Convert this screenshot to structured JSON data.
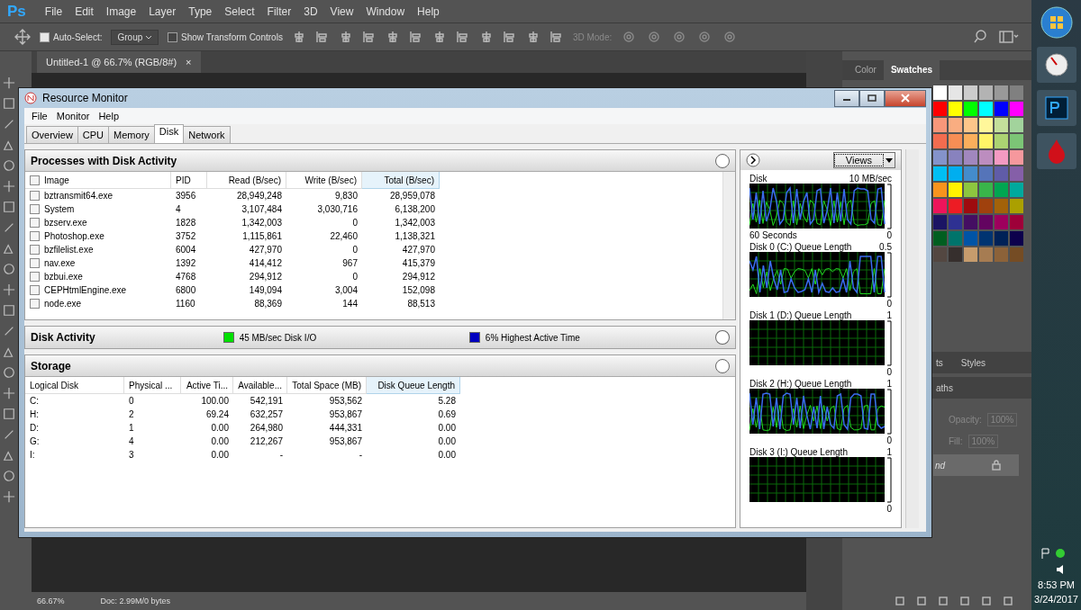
{
  "photoshop": {
    "logo": "Ps",
    "menu": [
      "File",
      "Edit",
      "Image",
      "Layer",
      "Type",
      "Select",
      "Filter",
      "3D",
      "View",
      "Window",
      "Help"
    ],
    "options": {
      "auto_select": {
        "label": "Auto-Select:",
        "checked": true
      },
      "group": "Group",
      "transform": {
        "label": "Show Transform Controls",
        "checked": false
      },
      "mode_3d": "3D Mode:"
    },
    "document_tab": {
      "title": "Untitled-1 @ 66.7% (RGB/8#)",
      "close": "×"
    },
    "panel_tabs": [
      {
        "label": "Color",
        "selected": false
      },
      {
        "label": "Swatches",
        "selected": true
      }
    ],
    "styles_tabs": [
      "ts",
      "Styles"
    ],
    "paths_tab": "aths",
    "opacity": {
      "label": "Opacity:",
      "value": "100%"
    },
    "fill": {
      "label": "Fill:",
      "value": "100%"
    },
    "layer": "nd",
    "status": {
      "zoom": "66.67%",
      "doc": "Doc: 2.99M/0 bytes"
    }
  },
  "resource_monitor": {
    "title": "Resource Monitor",
    "menu": [
      "File",
      "Monitor",
      "Help"
    ],
    "tabs": [
      {
        "label": "Overview",
        "selected": false
      },
      {
        "label": "CPU",
        "selected": false
      },
      {
        "label": "Memory",
        "selected": false
      },
      {
        "label": "Disk",
        "selected": true
      },
      {
        "label": "Network",
        "selected": false
      }
    ],
    "processes": {
      "title": "Processes with Disk Activity",
      "columns": [
        {
          "label": "Image",
          "sorted": false
        },
        {
          "label": "PID",
          "sorted": false
        },
        {
          "label": "Read (B/sec)",
          "sorted": false
        },
        {
          "label": "Write (B/sec)",
          "sorted": false
        },
        {
          "label": "Total (B/sec)",
          "sorted": true
        }
      ],
      "rows": [
        {
          "checked": false,
          "cells": [
            "bztransmit64.exe",
            "3956",
            "28,949,248",
            "9,830",
            "28,959,078"
          ]
        },
        {
          "checked": false,
          "cells": [
            "System",
            "4",
            "3,107,484",
            "3,030,716",
            "6,138,200"
          ]
        },
        {
          "checked": false,
          "cells": [
            "bzserv.exe",
            "1828",
            "1,342,003",
            "0",
            "1,342,003"
          ]
        },
        {
          "checked": false,
          "cells": [
            "Photoshop.exe",
            "3752",
            "1,115,861",
            "22,460",
            "1,138,321"
          ]
        },
        {
          "checked": false,
          "cells": [
            "bzfilelist.exe",
            "6004",
            "427,970",
            "0",
            "427,970"
          ]
        },
        {
          "checked": false,
          "cells": [
            "nav.exe",
            "1392",
            "414,412",
            "967",
            "415,379"
          ]
        },
        {
          "checked": false,
          "cells": [
            "bzbui.exe",
            "4768",
            "294,912",
            "0",
            "294,912"
          ]
        },
        {
          "checked": false,
          "cells": [
            "CEPHtmlEngine.exe",
            "6800",
            "149,094",
            "3,004",
            "152,098"
          ]
        },
        {
          "checked": false,
          "cells": [
            "node.exe",
            "1160",
            "88,369",
            "144",
            "88,513"
          ]
        }
      ]
    },
    "disk_activity": {
      "title": "Disk Activity",
      "legend": [
        {
          "label": "45 MB/sec Disk I/O",
          "color": "#00e000"
        },
        {
          "label": "6% Highest Active Time",
          "color": "#0000c0"
        }
      ]
    },
    "storage": {
      "title": "Storage",
      "columns": [
        {
          "label": "Logical Disk",
          "sorted": false
        },
        {
          "label": "Physical ...",
          "sorted": false
        },
        {
          "label": "Active Ti...",
          "sorted": false
        },
        {
          "label": "Available...",
          "sorted": false
        },
        {
          "label": "Total Space (MB)",
          "sorted": false
        },
        {
          "label": "Disk Queue Length",
          "sorted": true
        }
      ],
      "rows": [
        [
          "C:",
          "0",
          "100.00",
          "542,191",
          "953,562",
          "5.28"
        ],
        [
          "H:",
          "2",
          "69.24",
          "632,257",
          "953,867",
          "0.69"
        ],
        [
          "D:",
          "1",
          "0.00",
          "264,980",
          "444,331",
          "0.00"
        ],
        [
          "G:",
          "4",
          "0.00",
          "212,267",
          "953,867",
          "0.00"
        ],
        [
          "I:",
          "3",
          "0.00",
          "-",
          "-",
          "0.00"
        ]
      ]
    },
    "views_button": "Views",
    "graphs": [
      {
        "title": "Disk",
        "max": "10 MB/sec",
        "footer": "60 Seconds",
        "min": "0"
      },
      {
        "title": "Disk 0 (C:) Queue Length",
        "max": "0.5",
        "min": "0"
      },
      {
        "title": "Disk 1 (D:) Queue Length",
        "max": "1",
        "min": "0"
      },
      {
        "title": "Disk 2 (H:) Queue Length",
        "max": "1",
        "min": "0"
      },
      {
        "title": "Disk 3 (I:) Queue Length",
        "max": "1",
        "min": "0"
      }
    ]
  },
  "taskbar": {
    "time": "8:53 PM",
    "date": "3/24/2017"
  }
}
